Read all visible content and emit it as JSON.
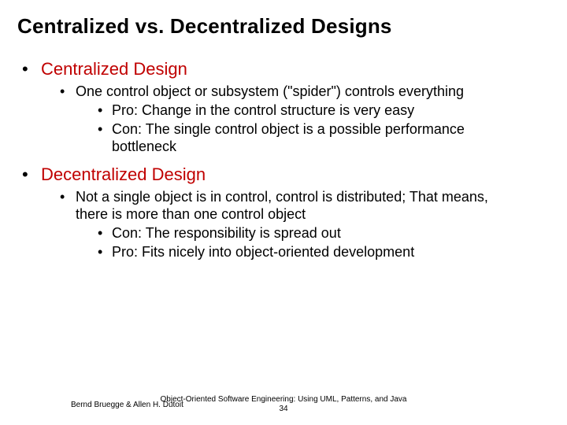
{
  "title": "Centralized vs. Decentralized Designs",
  "sections": {
    "centralized": {
      "heading": "Centralized Design",
      "desc": "One control object or subsystem (\"spider\") controls everything",
      "pro": "Pro: Change in the control structure is very easy",
      "con": "Con: The single control object is a possible performance bottleneck"
    },
    "decentralized": {
      "heading": "Decentralized Design",
      "desc": "Not a single object is in control, control is distributed; That means, there is more than one control object",
      "con": "Con: The responsibility is spread out",
      "pro": "Pro: Fits nicely into object-oriented development"
    }
  },
  "footer": {
    "authors": "Bernd Bruegge & Allen H. Dutoit",
    "book": "Object-Oriented Software Engineering: Using UML, Patterns, and Java",
    "page": "34"
  },
  "colors": {
    "heading": "#c00000"
  }
}
